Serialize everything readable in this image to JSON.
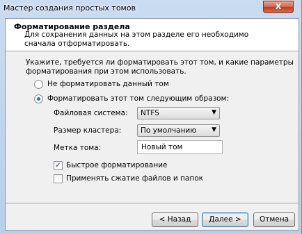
{
  "window": {
    "title": "Мастер создания простых томов",
    "close_symbol": "X"
  },
  "header": {
    "title": "Форматирование раздела",
    "description": "Для сохранения данных на этом разделе его необходимо сначала отформатировать."
  },
  "body": {
    "intro": "Укажите, требуется ли форматировать этот том, и какие параметры форматирования при этом использовать.",
    "option_no_format": "Не форматировать данный том",
    "option_format": "Форматировать этот том следующим образом:",
    "selected_option": "format"
  },
  "fields": {
    "filesystem_label": "Файловая система:",
    "filesystem_value": "NTFS",
    "cluster_label": "Размер кластера:",
    "cluster_value": "По умолчанию",
    "volume_label_label": "Метка тома:",
    "volume_label_value": "Новый том"
  },
  "checkboxes": {
    "quick_format": {
      "label": "Быстрое форматирование",
      "checked": true
    },
    "compression": {
      "label": "Применять сжатие файлов и папок",
      "checked": false
    }
  },
  "footer": {
    "back": "< Назад",
    "next": "Далее >",
    "cancel": "Отмена"
  },
  "icons": {
    "dropdown": "chevron-down-icon",
    "check": "check-icon",
    "close": "close-icon"
  }
}
